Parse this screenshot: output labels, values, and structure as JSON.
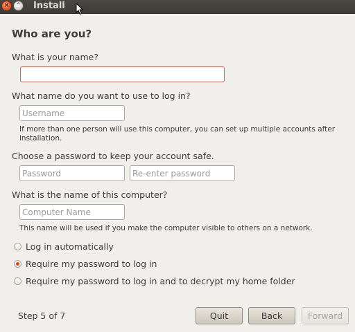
{
  "window": {
    "title": "Install"
  },
  "page": {
    "heading": "Who are you?"
  },
  "name": {
    "label": "What is your name?",
    "value": "",
    "placeholder": ""
  },
  "login": {
    "label": "What name do you want to use to log in?",
    "placeholder": "Username",
    "hint": "If more than one person will use this computer, you can set up multiple accounts after installation."
  },
  "password": {
    "label": "Choose a password to keep your account safe.",
    "placeholder": "Password",
    "confirm_placeholder": "Re-enter password"
  },
  "computer": {
    "label": "What is the name of this computer?",
    "placeholder": "Computer Name",
    "hint": "This name will be used if you make the computer visible to others on a network."
  },
  "login_options": [
    {
      "label": "Log in automatically",
      "checked": false
    },
    {
      "label": "Require my password to log in",
      "checked": true
    },
    {
      "label": "Require my password to log in and to decrypt my home folder",
      "checked": false
    }
  ],
  "footer": {
    "step": "Step 5 of 7",
    "quit": "Quit",
    "back": "Back",
    "forward": "Forward",
    "forward_enabled": false
  },
  "colors": {
    "accent": "#dd4814",
    "error_border": "#e2634c"
  }
}
